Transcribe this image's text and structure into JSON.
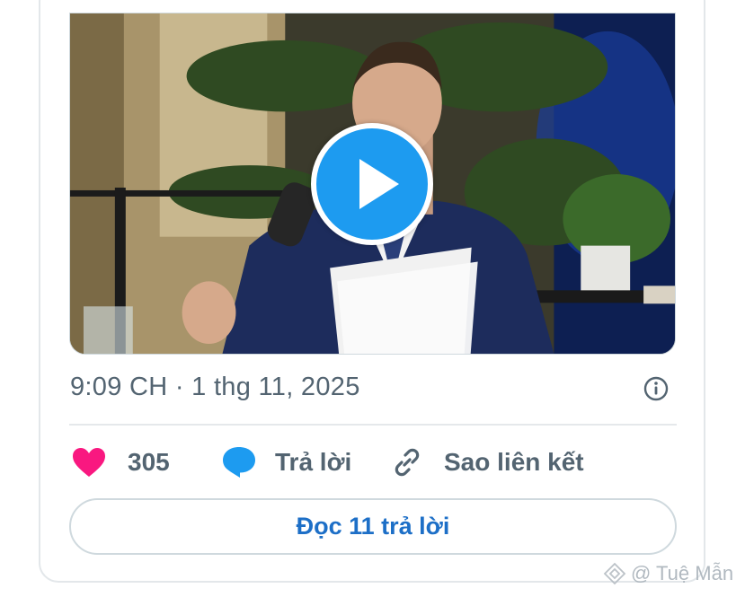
{
  "post": {
    "timestamp": "9:09 CH · 1 thg 11, 2025",
    "likes_count": "305",
    "reply_label": "Trả lời",
    "copy_link_label": "Sao liên kết",
    "read_replies_label": "Đọc 11 trả lời"
  },
  "watermark": {
    "text": "@ Tuệ Mẫn"
  },
  "icons": {
    "heart": "heart-icon",
    "reply": "speech-bubble-icon",
    "copy_link": "link-icon",
    "info": "info-icon",
    "play": "play-icon"
  },
  "colors": {
    "heart": "#f91880",
    "reply": "#1d9bf0",
    "play_button": "#1d9bf0",
    "link_text": "#1d6fc7",
    "secondary_text": "#536471"
  }
}
